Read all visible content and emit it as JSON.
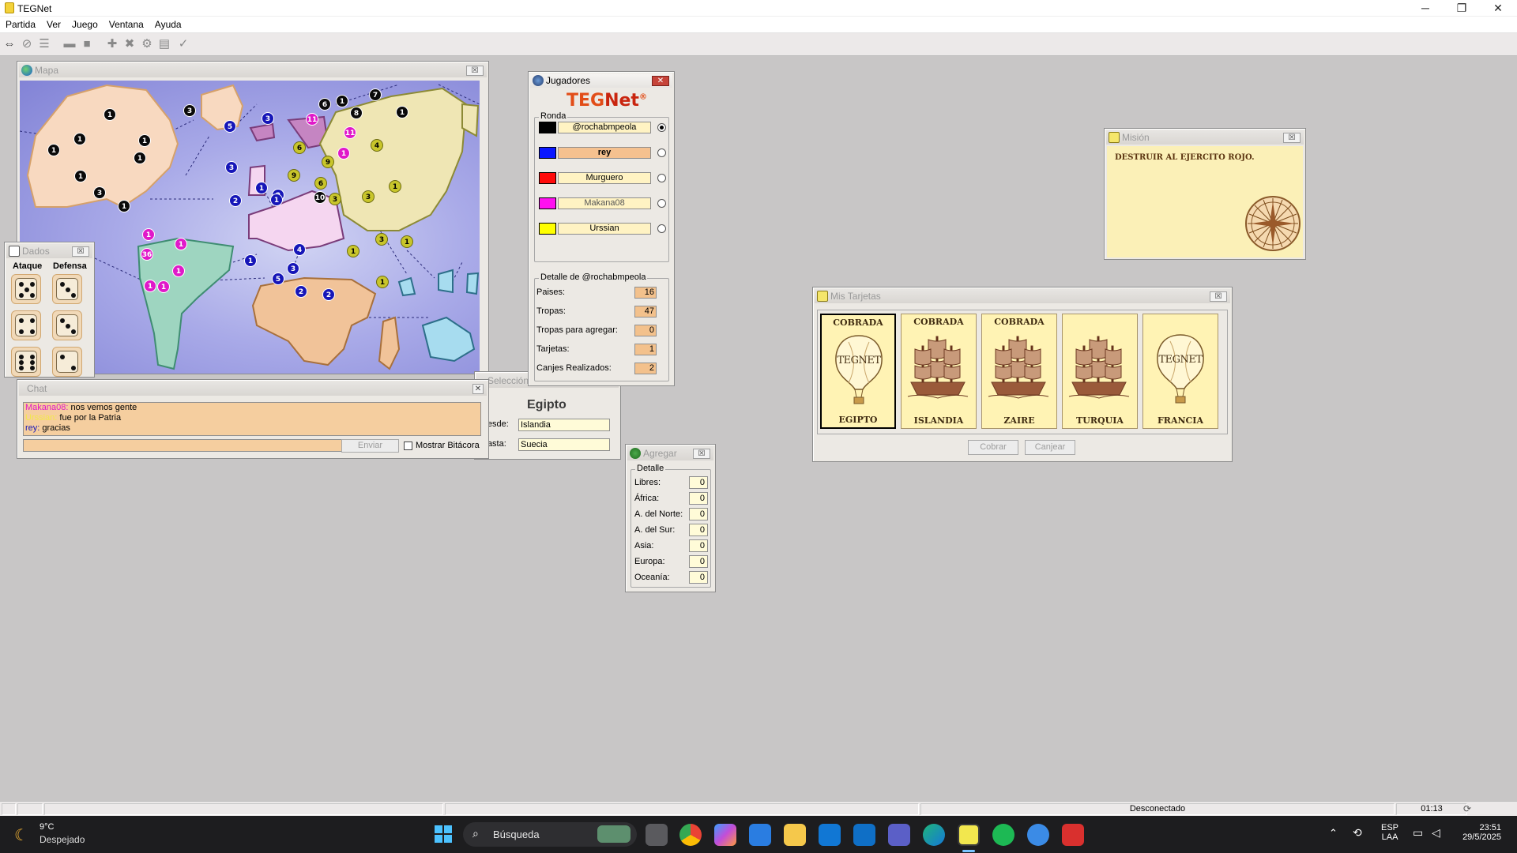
{
  "app": {
    "title": "TEGNet"
  },
  "window_controls": {
    "minimize": "─",
    "restore": "❐",
    "close": "✕"
  },
  "menu": [
    "Partida",
    "Ver",
    "Juego",
    "Ventana",
    "Ayuda"
  ],
  "toolbar_icons": [
    "connect-icon",
    "disconnect-icon",
    "list-icon",
    "map-icon",
    "stop-icon",
    "add-icon",
    "cancel-icon",
    "settings-icon",
    "card-icon",
    "check-icon"
  ],
  "map_window": {
    "title": "Mapa"
  },
  "map_tokens": [
    {
      "v": "1",
      "c": "k"
    },
    {
      "v": "1",
      "c": "k"
    },
    {
      "v": "1",
      "c": "k"
    },
    {
      "v": "1",
      "c": "k"
    },
    {
      "v": "1",
      "c": "k"
    },
    {
      "v": "1",
      "c": "k"
    },
    {
      "v": "3",
      "c": "k"
    },
    {
      "v": "1",
      "c": "k"
    },
    {
      "v": "3",
      "c": "k"
    },
    {
      "v": "5",
      "c": "b"
    },
    {
      "v": "3",
      "c": "b"
    },
    {
      "v": "3",
      "c": "b"
    },
    {
      "v": "1",
      "c": "b"
    },
    {
      "v": "2",
      "c": "b"
    },
    {
      "v": "2",
      "c": "b"
    },
    {
      "v": "1",
      "c": "b"
    },
    {
      "v": "1",
      "c": "b"
    },
    {
      "v": "4",
      "c": "b"
    },
    {
      "v": "3",
      "c": "b"
    },
    {
      "v": "5",
      "c": "b"
    },
    {
      "v": "2",
      "c": "b"
    },
    {
      "v": "2",
      "c": "b"
    },
    {
      "v": "6",
      "c": "k"
    },
    {
      "v": "1",
      "c": "k"
    },
    {
      "v": "7",
      "c": "k"
    },
    {
      "v": "8",
      "c": "k"
    },
    {
      "v": "1",
      "c": "k"
    },
    {
      "v": "10",
      "c": "k"
    },
    {
      "v": "11",
      "c": "m"
    },
    {
      "v": "11",
      "c": "m"
    },
    {
      "v": "1",
      "c": "m"
    },
    {
      "v": "1",
      "c": "m"
    },
    {
      "v": "36",
      "c": "m"
    },
    {
      "v": "1",
      "c": "m"
    },
    {
      "v": "1",
      "c": "m"
    },
    {
      "v": "1",
      "c": "m"
    },
    {
      "v": "1",
      "c": "m"
    },
    {
      "v": "6",
      "c": "y"
    },
    {
      "v": "9",
      "c": "y"
    },
    {
      "v": "9",
      "c": "y"
    },
    {
      "v": "4",
      "c": "y"
    },
    {
      "v": "6",
      "c": "y"
    },
    {
      "v": "3",
      "c": "y"
    },
    {
      "v": "3",
      "c": "y"
    },
    {
      "v": "1",
      "c": "y"
    },
    {
      "v": "3",
      "c": "y"
    },
    {
      "v": "1",
      "c": "y"
    },
    {
      "v": "1",
      "c": "y"
    },
    {
      "v": "1",
      "c": "y"
    }
  ],
  "dice_window": {
    "title": "Dados",
    "attack_label": "Ataque",
    "defense_label": "Defensa",
    "attack": [
      5,
      4,
      6
    ],
    "defense": [
      3,
      3,
      2
    ]
  },
  "chat_window": {
    "title": "Chat",
    "messages": [
      {
        "user": "Makana08:",
        "text": "nos vemos gente",
        "color": "#e019c9"
      },
      {
        "user": "Urssian:",
        "text": "fue por la Patria",
        "color": "#f2e84a"
      },
      {
        "user": "rey:",
        "text": "gracias",
        "color": "#1616b8"
      }
    ],
    "input_value": "",
    "send_label": "Enviar",
    "log_label": "Mostrar Bitácora"
  },
  "selection_window": {
    "title": "Selección",
    "country": "Egipto",
    "from_label": "Desde:",
    "from_value": "Islandia",
    "to_label": "Hasta:",
    "to_value": "Suecia"
  },
  "players_window": {
    "title": "Jugadores",
    "logo_a": "TEG",
    "logo_b": "Net",
    "logo_reg": "®",
    "round_label": "Ronda",
    "players": [
      {
        "name": "@rochabmpeola",
        "color": "#000000",
        "selected": true
      },
      {
        "name": "rey",
        "color": "#0a17ff",
        "selected": false
      },
      {
        "name": "Murguero",
        "color": "#ff0a0a",
        "selected": false
      },
      {
        "name": "Makana08",
        "color": "#ff10f0",
        "selected": false
      },
      {
        "name": "Urssian",
        "color": "#ffff00",
        "selected": false
      }
    ],
    "detail_label": "Detalle de @rochabmpeola",
    "details": [
      {
        "label": "Paises:",
        "value": "16"
      },
      {
        "label": "Tropas:",
        "value": "47"
      },
      {
        "label": "Tropas para agregar:",
        "value": "0"
      },
      {
        "label": "Tarjetas:",
        "value": "1"
      },
      {
        "label": "Canjes Realizados:",
        "value": "2"
      }
    ]
  },
  "add_window": {
    "title": "Agregar",
    "group_label": "Detalle",
    "rows": [
      {
        "label": "Libres:",
        "value": "0"
      },
      {
        "label": "África:",
        "value": "0"
      },
      {
        "label": "A. del Norte:",
        "value": "0"
      },
      {
        "label": "A. del Sur:",
        "value": "0"
      },
      {
        "label": "Asia:",
        "value": "0"
      },
      {
        "label": "Europa:",
        "value": "0"
      },
      {
        "label": "Oceanía:",
        "value": "0"
      }
    ]
  },
  "mission_window": {
    "title": "Misión",
    "text": "DESTRUIR AL EJERCITO ROJO."
  },
  "cards_window": {
    "title": "Mis Tarjetas",
    "cards": [
      {
        "top": "COBRADA",
        "country": "EGIPTO",
        "kind": "balloon",
        "balloon_text": "TEGNET",
        "selected": true
      },
      {
        "top": "COBRADA",
        "country": "ISLANDIA",
        "kind": "ship",
        "selected": false
      },
      {
        "top": "COBRADA",
        "country": "ZAIRE",
        "kind": "ship",
        "selected": false
      },
      {
        "top": "",
        "country": "TURQUIA",
        "kind": "ship",
        "selected": false
      },
      {
        "top": "",
        "country": "FRANCIA",
        "kind": "balloon",
        "balloon_text": "TEGNET",
        "selected": false
      }
    ],
    "collect_label": "Cobrar",
    "exchange_label": "Canjear"
  },
  "statusbar": {
    "status": "Desconectado",
    "time": "01:13"
  },
  "taskbar": {
    "weather_temp": "9°C",
    "weather_desc": "Despejado",
    "search_placeholder": "Búsqueda",
    "lang_a": "ESP",
    "lang_b": "LAA",
    "clock_time": "23:51",
    "clock_date": "29/5/2025",
    "apps": [
      "windows-start-icon",
      "search-icon",
      "task-view-icon",
      "chrome-icon",
      "copilot-icon",
      "store-icon",
      "file-explorer-icon",
      "outlook-icon",
      "mail-icon",
      "teams-icon",
      "edge-icon",
      "tegnet-icon",
      "spotify-icon",
      "misc-app-icon",
      "ea-icon"
    ]
  }
}
